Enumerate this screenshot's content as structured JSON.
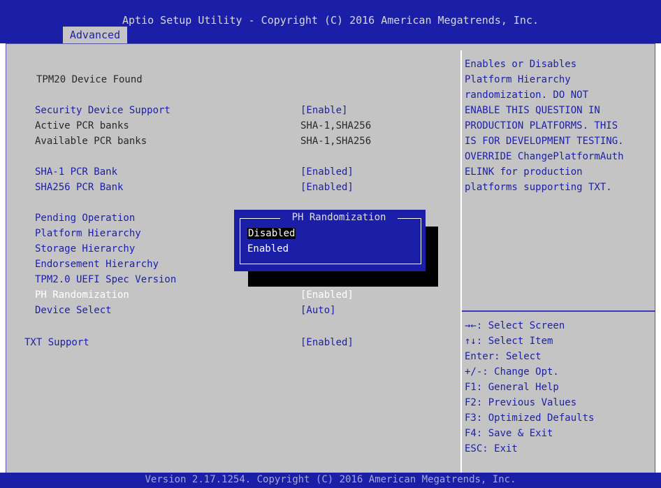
{
  "header": {
    "title": "Aptio Setup Utility - Copyright (C) 2016 American Megatrends, Inc.",
    "tab": "Advanced"
  },
  "main": {
    "device_found": "TPM20 Device Found",
    "rows": [
      {
        "label": "Security Device Support",
        "value": "[Enable]"
      },
      {
        "label": "Active PCR banks",
        "value": "SHA-1,SHA256"
      },
      {
        "label": "Available PCR banks",
        "value": "SHA-1,SHA256"
      },
      {
        "label": "SHA-1 PCR Bank",
        "value": "[Enabled]"
      },
      {
        "label": "SHA256 PCR Bank",
        "value": "[Enabled]"
      },
      {
        "label": "Pending Operation",
        "value": ""
      },
      {
        "label": "Platform Hierarchy",
        "value": ""
      },
      {
        "label": "Storage Hierarchy",
        "value": ""
      },
      {
        "label": "Endorsement Hierarchy",
        "value": ""
      },
      {
        "label": "TPM2.0 UEFI Spec Version",
        "value": ""
      },
      {
        "label": "PH Randomization",
        "value": "[Enabled]"
      },
      {
        "label": "Device Select",
        "value": "[Auto]"
      },
      {
        "label": "TXT Support",
        "value": "[Enabled]"
      }
    ]
  },
  "popup": {
    "title": "PH Randomization",
    "options": [
      "Disabled",
      "Enabled"
    ],
    "selected": "Disabled"
  },
  "help": {
    "description": [
      "Enables or Disables",
      "Platform Hierarchy",
      "randomization. DO NOT",
      "ENABLE THIS QUESTION IN",
      "PRODUCTION PLATFORMS. THIS",
      "IS FOR DEVELOPMENT TESTING.",
      "OVERRIDE ChangePlatformAuth",
      "ELINK for production",
      "platforms supporting TXT."
    ],
    "keys": [
      "→←: Select Screen",
      "↑↓: Select Item",
      "Enter: Select",
      "+/-: Change Opt.",
      "F1: General Help",
      "F2: Previous Values",
      "F3: Optimized Defaults",
      "F4: Save & Exit",
      "ESC: Exit"
    ]
  },
  "footer": {
    "text": "Version 2.17.1254. Copyright (C) 2016 American Megatrends, Inc."
  }
}
